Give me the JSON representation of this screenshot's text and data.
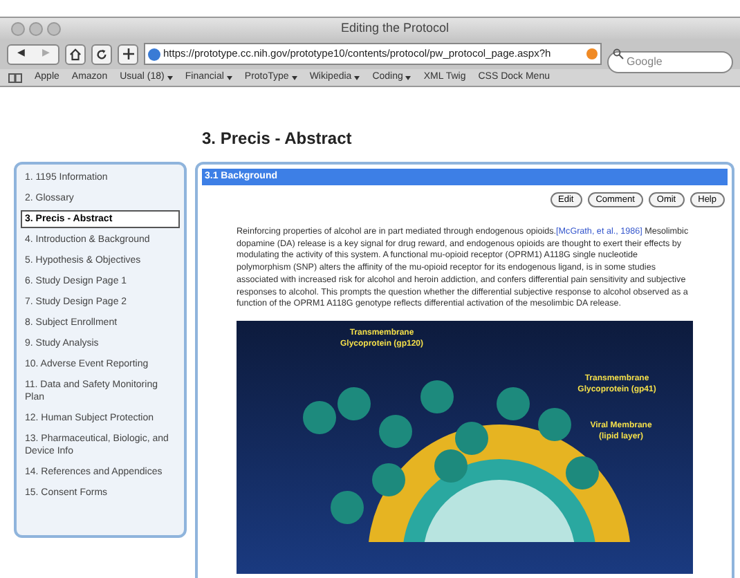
{
  "window": {
    "title": "Editing the Protocol"
  },
  "toolbar": {
    "back": "◀",
    "forward": "▶",
    "url": "https://prototype.cc.nih.gov/prototype10/contents/protocol/pw_protocol_page.aspx?h",
    "search": {
      "placeholder": "Google"
    }
  },
  "bookmarks": [
    {
      "label": "Apple",
      "menu": false
    },
    {
      "label": "Amazon",
      "menu": false
    },
    {
      "label": "Usual (18)",
      "menu": true
    },
    {
      "label": "Financial",
      "menu": true
    },
    {
      "label": "ProtoType",
      "menu": true
    },
    {
      "label": "Wikipedia",
      "menu": true
    },
    {
      "label": "Coding",
      "menu": true
    },
    {
      "label": "XML Twig",
      "menu": false
    },
    {
      "label": "CSS Dock Menu",
      "menu": false
    }
  ],
  "page": {
    "heading": "3. Precis - Abstract"
  },
  "sidebar": {
    "items": [
      {
        "label": "1. 1195 Information",
        "selected": false
      },
      {
        "label": "2. Glossary",
        "selected": false
      },
      {
        "label": "3. Precis - Abstract",
        "selected": true
      },
      {
        "label": "4. Introduction & Background",
        "selected": false
      },
      {
        "label": "5. Hypothesis & Objectives",
        "selected": false
      },
      {
        "label": "6. Study Design Page 1",
        "selected": false
      },
      {
        "label": "7. Study Design Page 2",
        "selected": false
      },
      {
        "label": "8. Subject Enrollment",
        "selected": false
      },
      {
        "label": "9. Study Analysis",
        "selected": false
      },
      {
        "label": "10. Adverse Event Reporting",
        "selected": false
      },
      {
        "label": "11. Data and Safety Monitoring Plan",
        "selected": false
      },
      {
        "label": "12. Human Subject Protection",
        "selected": false
      },
      {
        "label": "13. Pharmaceutical, Biologic, and Device Info",
        "selected": false
      },
      {
        "label": "14. References and Appendices",
        "selected": false
      },
      {
        "label": "15. Consent Forms",
        "selected": false
      }
    ]
  },
  "section": {
    "title": "3.1 Background",
    "buttons": [
      "Edit",
      "Comment",
      "Omit",
      "Help"
    ],
    "paragraph": {
      "before": "Reinforcing properties of alcohol are in part mediated through endogenous opioids.",
      "link": "[McGrath, et al., 1986]",
      "after": " Mesolimbic dopamine (DA) release is a key signal for drug reward, and endogenous opioids are thought to exert their effects by modulating the activity of this system. A functional mu-opioid receptor (OPRM1) A118G single nucleotide polymorphism (SNP) alters the affinity of the mu-opioid receptor for its endogenous ligand, is in some studies associated with increased risk for alcohol and heroin addiction, and confers differential pain sensitivity and subjective responses to alcohol. This prompts the question whether the differential subjective response to alcohol observed as a function of the OPRM1 A118G genotype reflects differential activation of the mesolimbic DA release."
    },
    "figure_labels": [
      "Transmembrane Glycoprotein (gp120)",
      "Transmembrane Glycoprotein (gp41)",
      "Viral Membrane (lipid layer)"
    ]
  }
}
